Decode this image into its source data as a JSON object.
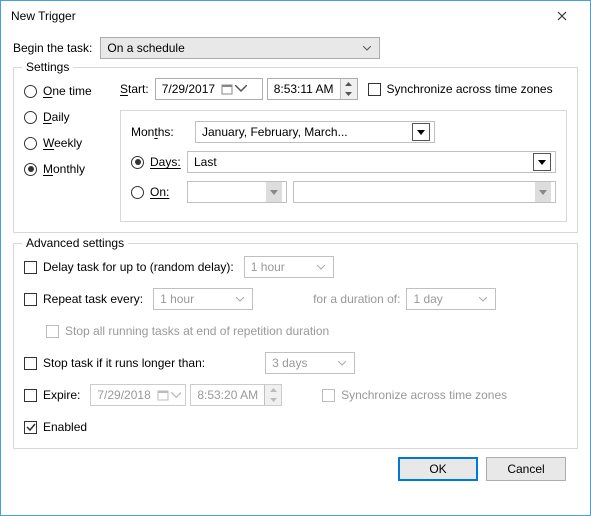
{
  "title": "New Trigger",
  "begin_label": "Begin the task:",
  "begin_value": "On a schedule",
  "settings": {
    "legend": "Settings",
    "freq": {
      "one_time": "One time",
      "daily": "Daily",
      "weekly": "Weekly",
      "monthly": "Monthly"
    },
    "start_label": "Start:",
    "start_date": "7/29/2017",
    "start_time": "8:53:11 AM",
    "sync_tz": "Synchronize across time zones",
    "months_label": "Months:",
    "months_value": "January, February, March...",
    "days_label": "Days:",
    "days_value": "Last",
    "on_label": "On:",
    "on_value1": "",
    "on_value2": ""
  },
  "advanced": {
    "legend": "Advanced settings",
    "delay_label": "Delay task for up to (random delay):",
    "delay_value": "1 hour",
    "repeat_label": "Repeat task every:",
    "repeat_value": "1 hour",
    "duration_label": "for a duration of:",
    "duration_value": "1 day",
    "stop_all": "Stop all running tasks at end of repetition duration",
    "stop_if_label": "Stop task if it runs longer than:",
    "stop_if_value": "3 days",
    "expire_label": "Expire:",
    "expire_date": "7/29/2018",
    "expire_time": "8:53:20 AM",
    "sync_tz2": "Synchronize across time zones",
    "enabled": "Enabled"
  },
  "buttons": {
    "ok": "OK",
    "cancel": "Cancel"
  }
}
